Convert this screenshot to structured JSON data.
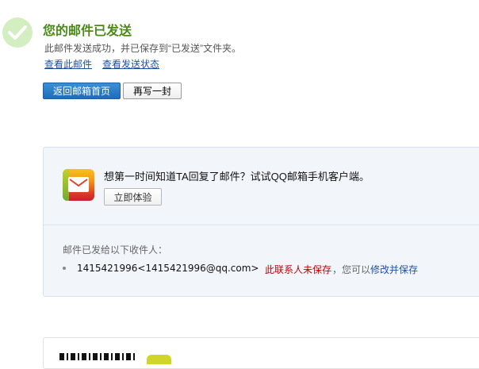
{
  "result": {
    "title": "您的邮件已发送",
    "subtitle": "此邮件发送成功，并已保存到“已发送”文件夹。",
    "view_mail_link": "查看此邮件",
    "view_status_link": "查看发送状态"
  },
  "actions": {
    "back_label": "返回邮箱首页",
    "rewrite_label": "再写一封"
  },
  "promo": {
    "text": "想第一时间知道TA回复了邮件？试试QQ邮箱手机客户端。",
    "try_label": "立即体验"
  },
  "recipients": {
    "label": "邮件已发给以下收件人：",
    "items": [
      {
        "address": "1415421996<1415421996@qq.com>",
        "status": "此联系人未保存",
        "separator": "，",
        "hint": "您可以修改并保存",
        "edit_link": "修改并保存"
      }
    ]
  },
  "colors": {
    "title_green": "#4a8a16",
    "link_blue": "#1e50a2",
    "warning_red": "#c00000",
    "primary_button": "#1f6cb8"
  },
  "icons": [
    "success-check-icon",
    "qq-mail-app-icon",
    "envelope-icon",
    "bullet-icon",
    "qr-code-icon"
  ]
}
